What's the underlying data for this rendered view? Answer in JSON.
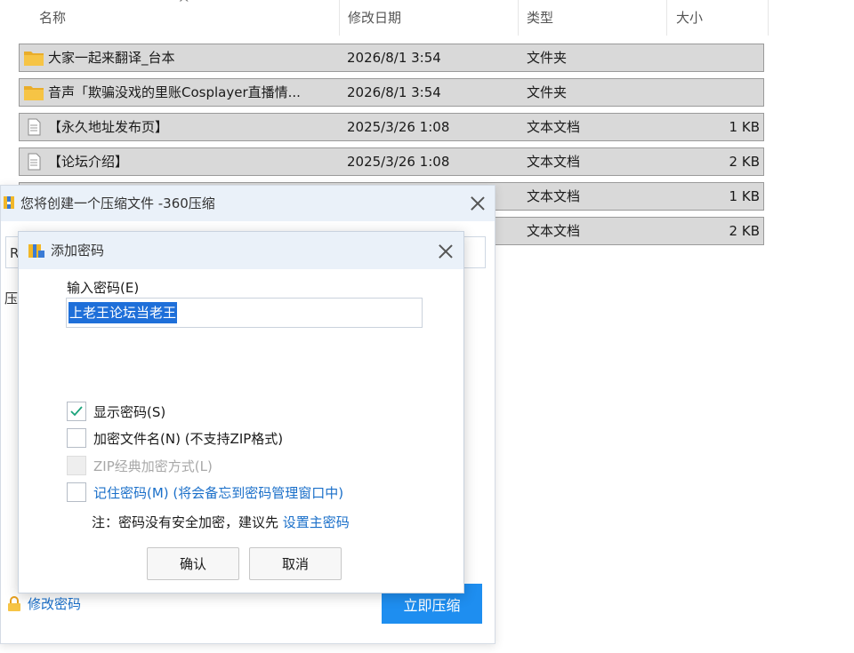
{
  "explorer": {
    "columns": {
      "name": "名称",
      "date": "修改日期",
      "type": "类型",
      "size": "大小"
    },
    "rows": [
      {
        "icon": "folder-icon",
        "name": "大家一起来翻译_台本",
        "date": "2026/8/1 3:54",
        "type": "文件夹",
        "size": ""
      },
      {
        "icon": "folder-icon",
        "name": "音声「欺骗没戏的里账Cosplayer直播情...",
        "date": "2026/8/1 3:54",
        "type": "文件夹",
        "size": ""
      },
      {
        "icon": "text-file-icon",
        "name": "【永久地址发布页】",
        "date": "2025/3/26 1:08",
        "type": "文本文档",
        "size": "1 KB"
      },
      {
        "icon": "text-file-icon",
        "name": "【论坛介绍】",
        "date": "2025/3/26 1:08",
        "type": "文本文档",
        "size": "2 KB"
      },
      {
        "icon": "text-file-icon",
        "name": "",
        "date": "",
        "type": "文本文档",
        "size": "1 KB"
      },
      {
        "icon": "text-file-icon",
        "name": "",
        "date": "",
        "type": "文本文档",
        "size": "2 KB"
      }
    ]
  },
  "main_window": {
    "title": "您将创建一个压缩文件 -360压缩",
    "input_partial": "R",
    "label_partial": "压",
    "modify_password": "修改密码",
    "compress_now": "立即压缩"
  },
  "password_dialog": {
    "title": "添加密码",
    "input_label": "输入密码(E)",
    "password_value": "上老王论坛当老王",
    "options": {
      "show_password": "显示密码(S)",
      "encrypt_filenames": "加密文件名(N) (不支持ZIP格式)",
      "zip_classic": "ZIP经典加密方式(L)",
      "remember_password": "记住密码(M) (将会备忘到密码管理窗口中)"
    },
    "note_text": "注：密码没有安全加密，建议先 ",
    "note_link": "设置主密码",
    "ok": "确认",
    "cancel": "取消"
  },
  "colors": {
    "accent": "#1e8ef0",
    "link": "#1a6fc9",
    "title_bar": "#eaf1f9",
    "row_selected": "#d9d9d9",
    "folder": "#f6c445",
    "check": "#1aa37a"
  }
}
